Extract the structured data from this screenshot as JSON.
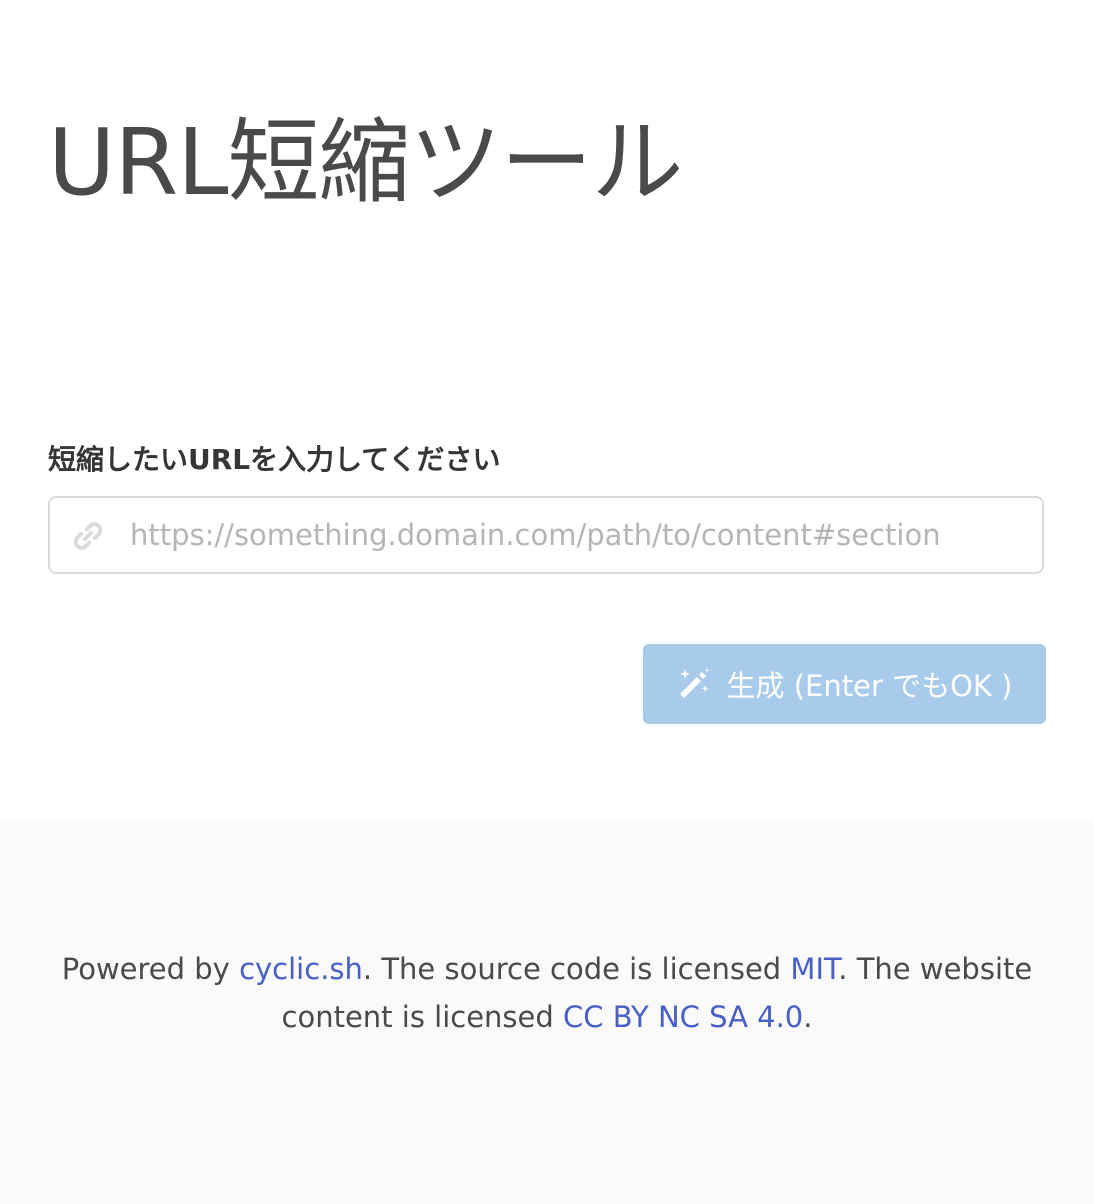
{
  "page": {
    "title": "URL短縮ツール"
  },
  "form": {
    "label": "短縮したいURLを入力してください",
    "input_placeholder": "https://something.domain.com/path/to/content#section",
    "input_value": "",
    "input_icon": "link-icon",
    "button_label": "生成 (Enter でもOK )",
    "button_icon": "magic-wand-icon",
    "button_color": "#a8cbeb"
  },
  "footer": {
    "powered_by": "Powered by ",
    "cyclic_link": "cyclic.sh",
    "text_source": ". The source code is licensed ",
    "mit_link": "MIT",
    "text_website": ". The website content is licensed ",
    "cc_link": "CC BY NC SA 4.0",
    "text_end": ".",
    "link_color": "#485fc7",
    "background": "#fafafa"
  }
}
